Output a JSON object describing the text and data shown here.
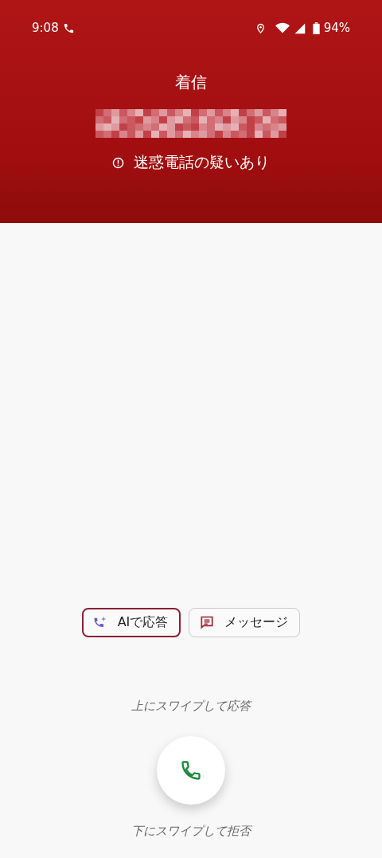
{
  "status_bar": {
    "time": "9:08",
    "battery": "94%"
  },
  "call": {
    "label": "着信",
    "warning": "迷惑電話の疑いあり"
  },
  "actions": [
    {
      "kind": "ai",
      "label": "AIで応答",
      "selected": true
    },
    {
      "kind": "message",
      "label": "メッセージ",
      "selected": false
    }
  ],
  "swipe_up_hint": "上にスワイプして応答",
  "swipe_down_hint": "下にスワイプして拒否"
}
